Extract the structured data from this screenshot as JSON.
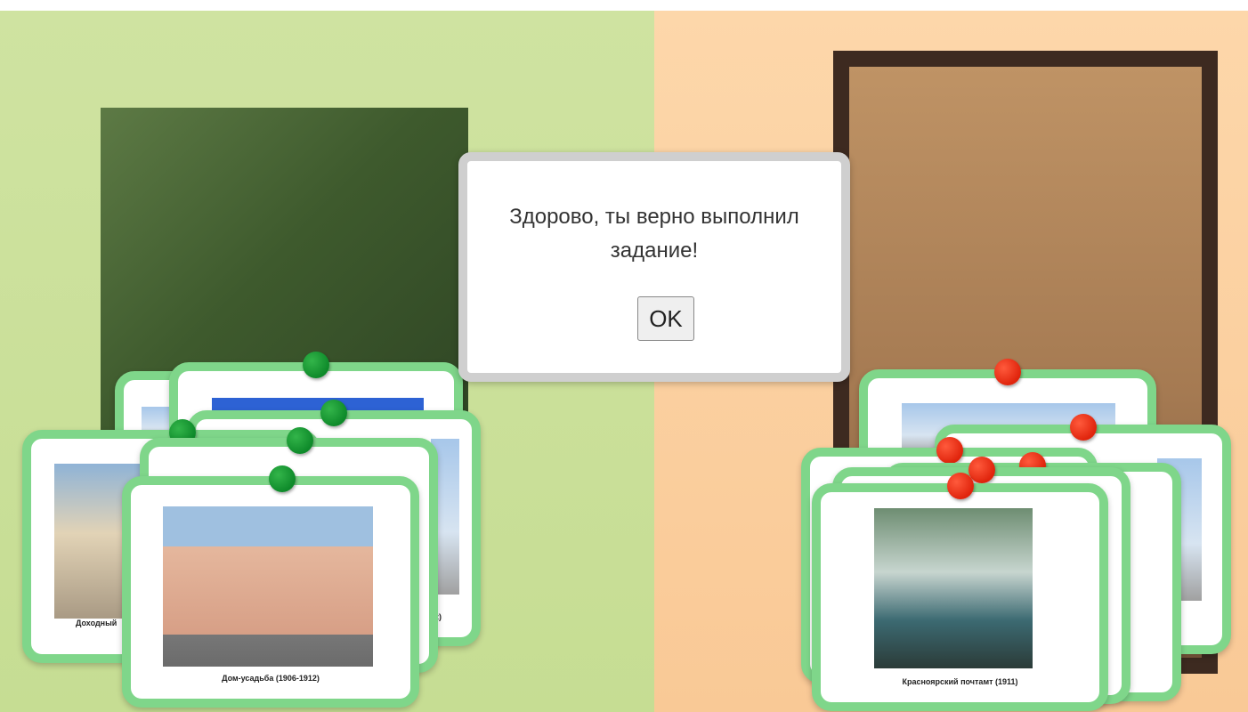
{
  "dialog": {
    "message": "Здорово, ты верно выполнил задание!",
    "ok_label": "OK"
  },
  "left_group": {
    "pin_color": "#0e8a2a",
    "cards": [
      {
        "caption": ""
      },
      {
        "caption": ""
      },
      {
        "caption": ""
      },
      {
        "caption": "Доходный"
      },
      {
        "caption": "z)"
      },
      {
        "caption": "Дом-усадьба (1906-1912)"
      }
    ]
  },
  "right_group": {
    "pin_color": "#e0240c",
    "cards": [
      {
        "caption": ""
      },
      {
        "caption": ""
      },
      {
        "caption": ""
      },
      {
        "caption": ""
      },
      {
        "caption": "Красноярский почтамт (1911)"
      }
    ]
  },
  "colors": {
    "left_bg": "#cfe3a1",
    "right_bg": "#fdd7aa",
    "card_border": "#7fd68a"
  }
}
